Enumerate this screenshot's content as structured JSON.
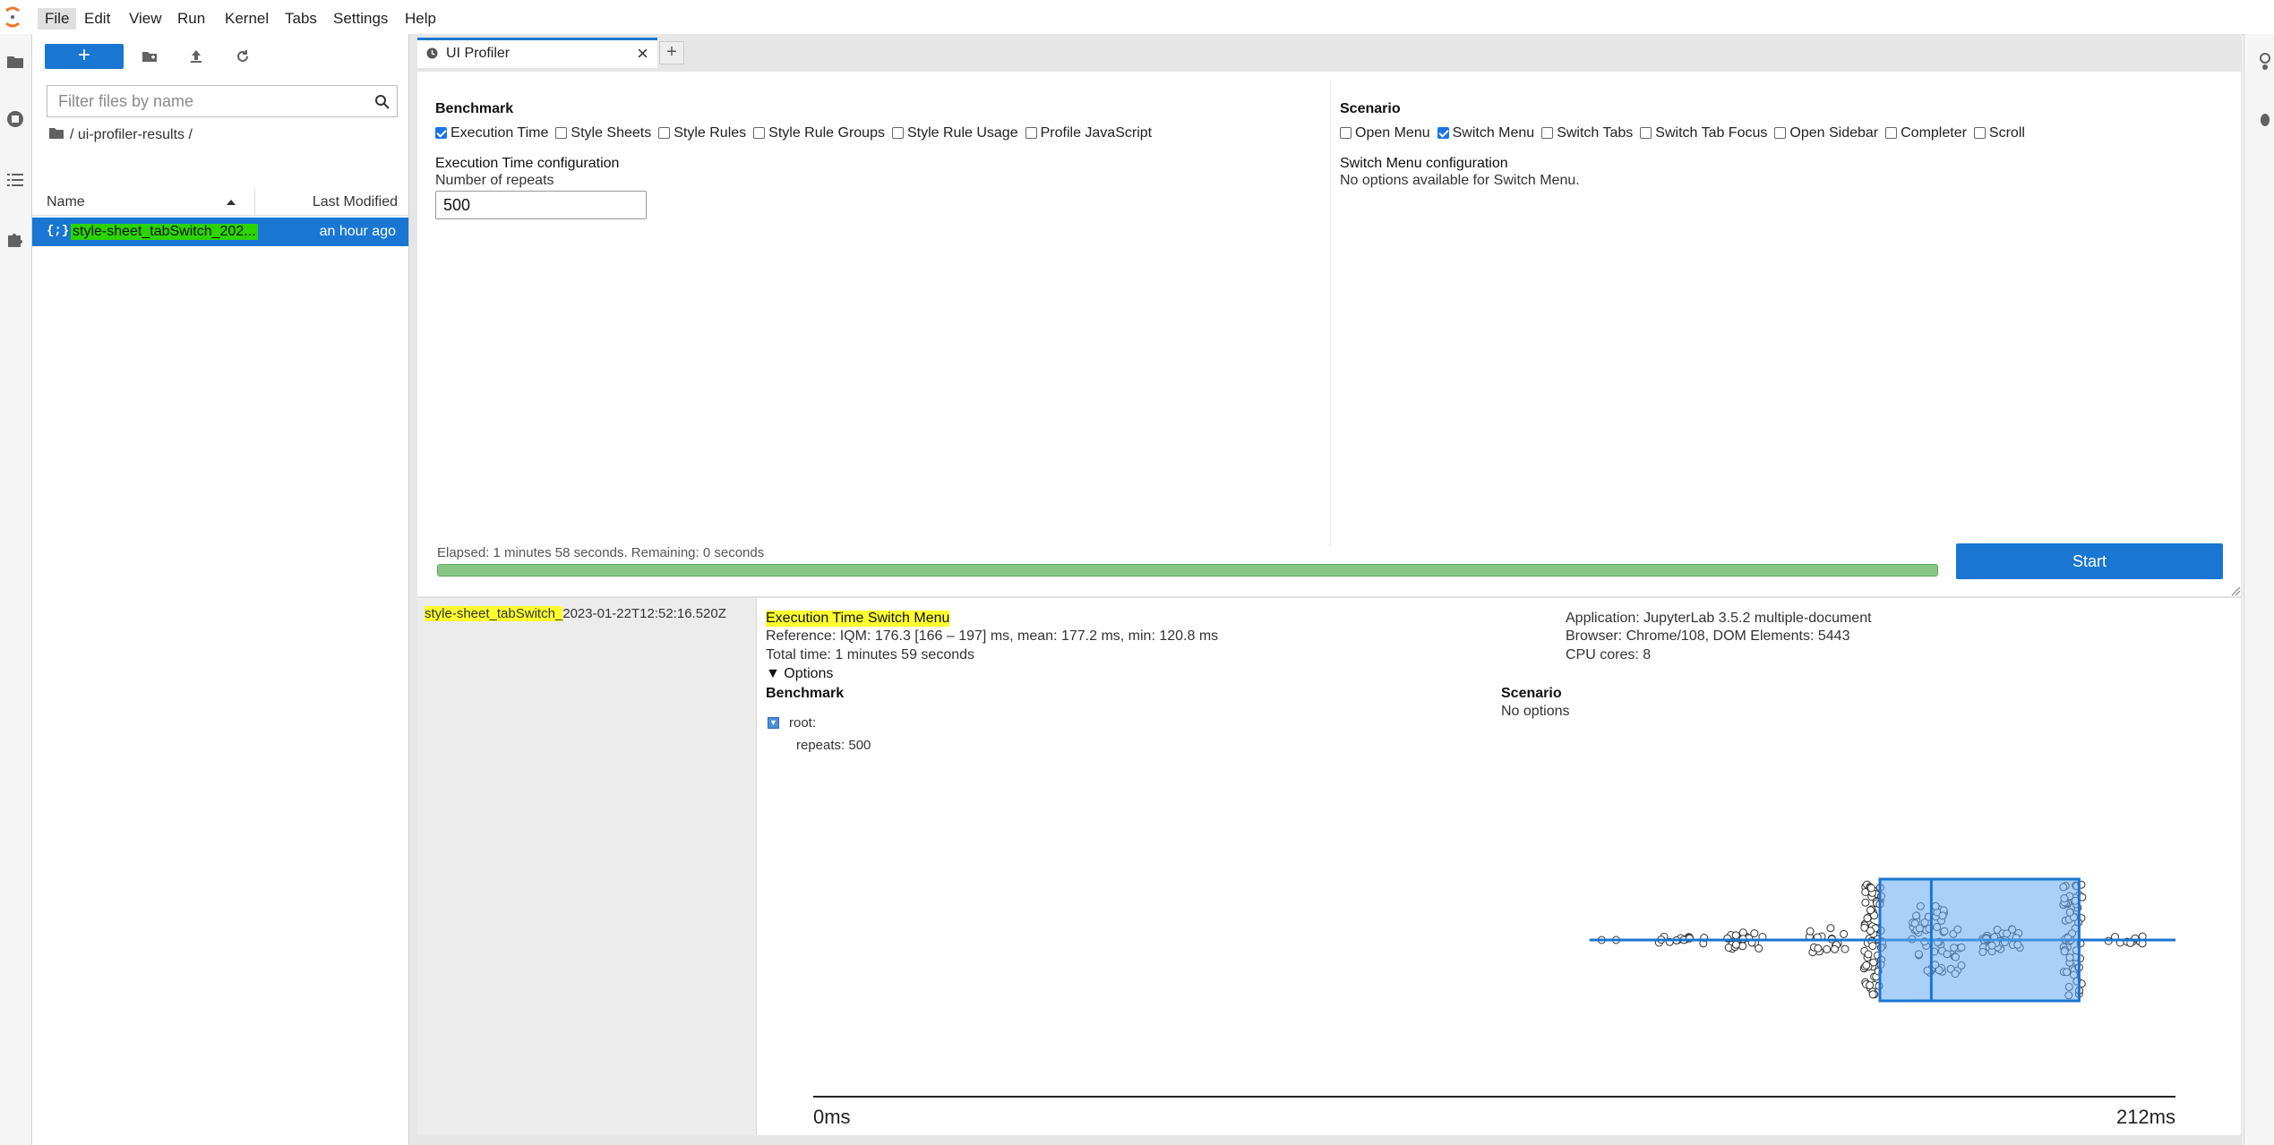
{
  "menu": [
    "File",
    "Edit",
    "View",
    "Run",
    "Kernel",
    "Tabs",
    "Settings",
    "Help"
  ],
  "filebrowser": {
    "new_label": "+",
    "filter_placeholder": "Filter files by name",
    "breadcrumb": "/ ui-profiler-results /",
    "col_name": "Name",
    "col_modified": "Last Modified",
    "row_name": "style-sheet_tabSwitch_202...",
    "row_modified": "an hour ago"
  },
  "tab": {
    "title": "UI Profiler",
    "close": "×",
    "add": "+"
  },
  "benchmark": {
    "heading": "Benchmark",
    "options": [
      {
        "label": "Execution Time",
        "checked": true
      },
      {
        "label": "Style Sheets",
        "checked": false
      },
      {
        "label": "Style Rules",
        "checked": false
      },
      {
        "label": "Style Rule Groups",
        "checked": false
      },
      {
        "label": "Style Rule Usage",
        "checked": false
      },
      {
        "label": "Profile JavaScript",
        "checked": false
      }
    ],
    "config_title": "Execution Time configuration",
    "repeats_label": "Number of repeats",
    "repeats_value": "500"
  },
  "scenario": {
    "heading": "Scenario",
    "options": [
      {
        "label": "Open Menu",
        "checked": false
      },
      {
        "label": "Switch Menu",
        "checked": true
      },
      {
        "label": "Switch Tabs",
        "checked": false
      },
      {
        "label": "Switch Tab Focus",
        "checked": false
      },
      {
        "label": "Open Sidebar",
        "checked": false
      },
      {
        "label": "Completer",
        "checked": false
      },
      {
        "label": "Scroll",
        "checked": false
      }
    ],
    "config_title": "Switch Menu configuration",
    "config_text": "No options available for Switch Menu."
  },
  "progress": {
    "status": "Elapsed: 1 minutes 58 seconds. Remaining: 0 seconds",
    "fraction": 1.0,
    "start_label": "Start"
  },
  "result": {
    "file_hl": "style-sheet_tabSwitch_",
    "file_rest": "2023-01-22T12:52:16.520Z",
    "title": "Execution Time Switch Menu",
    "reference": "Reference: IQM: 176.3 [166 – 197] ms, mean: 177.2 ms, min: 120.8 ms",
    "total_time": "Total time: 1 minutes 59 seconds",
    "options_toggle": "▼ Options",
    "application": "Application: JupyterLab 3.5.2 multiple-document",
    "browser": "Browser: Chrome/108, DOM Elements: 5443",
    "cpu": "CPU cores: 8",
    "bench_heading": "Benchmark",
    "root_label": "root:",
    "repeats_line": "repeats:  500",
    "scenario_heading": "Scenario",
    "scenario_text": "No options"
  },
  "chart_data": {
    "type": "box-swarm",
    "axis_min_label": "0ms",
    "axis_max_label": "212ms",
    "xlim": [
      0,
      212
    ],
    "box": {
      "q1": 166,
      "median": 174,
      "q3": 197,
      "whisker_low": 120.8,
      "whisker_high": 212
    },
    "color": "#1976d2"
  }
}
